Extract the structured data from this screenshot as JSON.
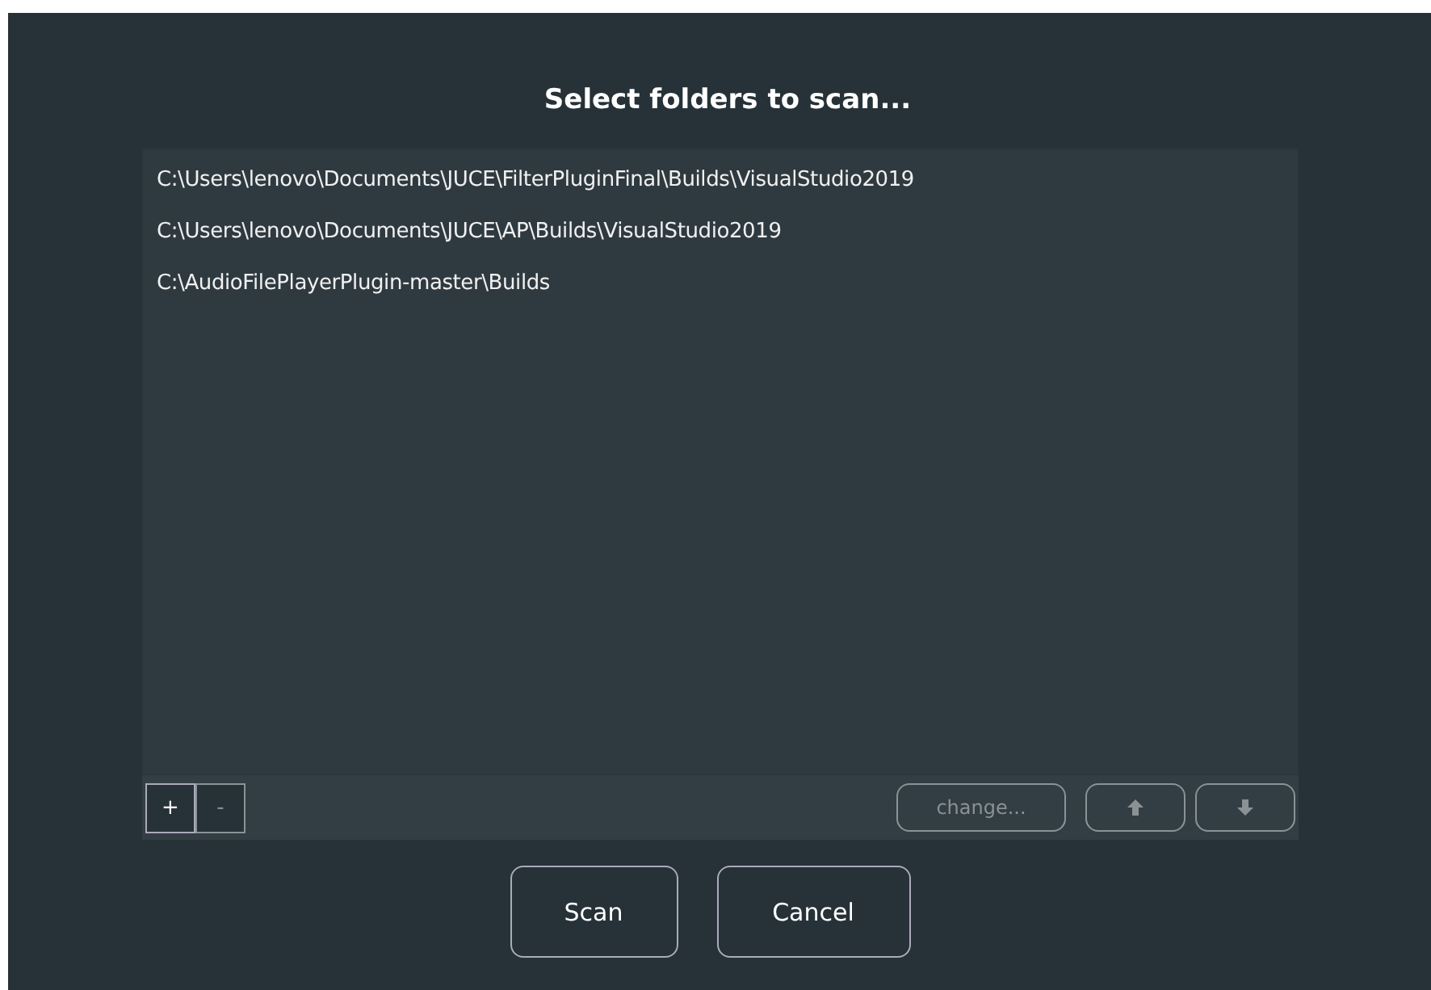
{
  "dialog": {
    "title": "Select folders to scan..."
  },
  "folders": [
    {
      "path": "C:\\Users\\lenovo\\Documents\\JUCE\\FilterPluginFinal\\Builds\\VisualStudio2019",
      "selected": false
    },
    {
      "path": "C:\\Users\\lenovo\\Documents\\JUCE\\AP\\Builds\\VisualStudio2019",
      "selected": false
    },
    {
      "path": "C:\\AudioFilePlayerPlugin-master\\Builds",
      "selected": false
    }
  ],
  "toolbar": [
    {
      "kind": "add",
      "label": "+",
      "disabled": false
    },
    {
      "kind": "remove",
      "label": "-",
      "disabled": true
    },
    {
      "kind": "change",
      "label": "change...",
      "disabled": true
    },
    {
      "kind": "up",
      "disabled": true
    },
    {
      "kind": "down",
      "disabled": true
    }
  ],
  "buttons": [
    "Scan",
    "Cancel"
  ]
}
